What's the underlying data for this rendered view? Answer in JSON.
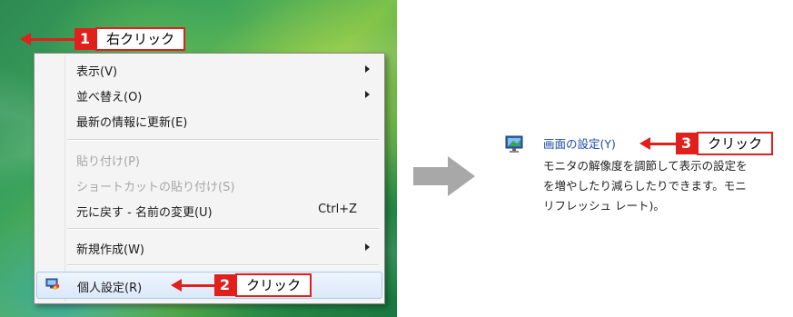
{
  "callouts": [
    {
      "num": "1",
      "label": "右クリック"
    },
    {
      "num": "2",
      "label": "クリック"
    },
    {
      "num": "3",
      "label": "クリック"
    }
  ],
  "context_menu": {
    "items": [
      {
        "label": "表示(V)",
        "shortcut": "",
        "submenu": true,
        "disabled": false
      },
      {
        "label": "並べ替え(O)",
        "shortcut": "",
        "submenu": true,
        "disabled": false
      },
      {
        "label": "最新の情報に更新(E)",
        "shortcut": "",
        "submenu": false,
        "disabled": false
      },
      {
        "label": "貼り付け(P)",
        "shortcut": "",
        "submenu": false,
        "disabled": true
      },
      {
        "label": "ショートカットの貼り付け(S)",
        "shortcut": "",
        "submenu": false,
        "disabled": true
      },
      {
        "label": "元に戻す - 名前の変更(U)",
        "shortcut": "Ctrl+Z",
        "submenu": false,
        "disabled": false
      },
      {
        "label": "新規作成(W)",
        "shortcut": "",
        "submenu": true,
        "disabled": false
      },
      {
        "label": "個人設定(R)",
        "shortcut": "",
        "submenu": false,
        "disabled": false
      }
    ]
  },
  "display_settings": {
    "link": "画面の設定(Y)",
    "description_lines": [
      "モニタの解像度を調節して表示の設定を",
      "を増やしたり減らしたりできます。モニ",
      "リフレッシュ レート)。"
    ]
  },
  "colors": {
    "callout_red": "#e0201c",
    "link_blue": "#1a4aa8",
    "arrow_gray": "#a8a8a8",
    "menu_bg": "#f4f4f4",
    "highlight_border": "#a9c9ee"
  },
  "icons": [
    "arrow-left-icon",
    "submenu-arrow-icon",
    "personalize-icon",
    "gray-right-arrow-icon",
    "monitor-icon"
  ]
}
